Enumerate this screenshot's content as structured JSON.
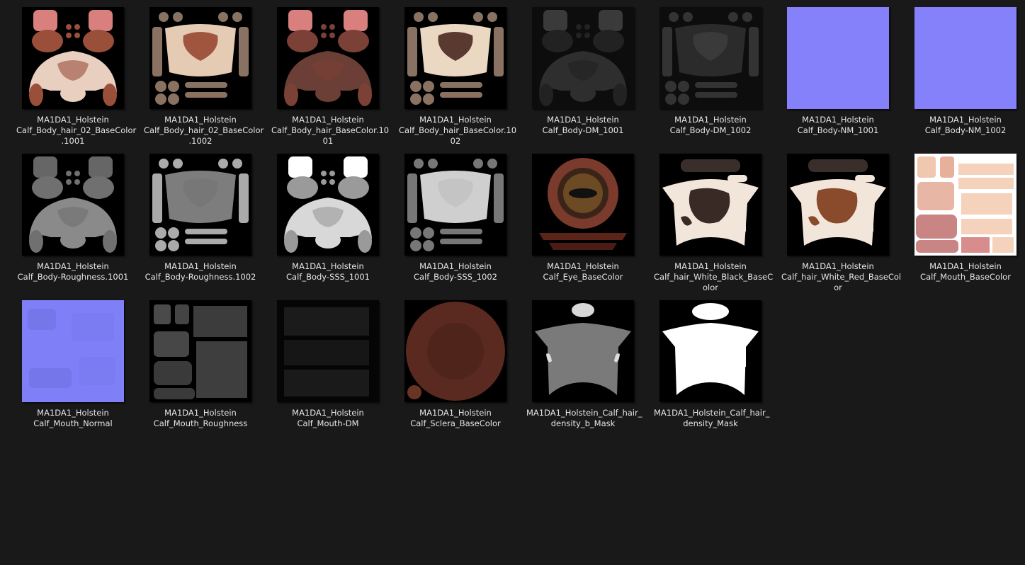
{
  "files": [
    {
      "name": "MA1DA1_Holstein\nCalf_Body_hair_02_BaseColor\n.1001",
      "thumb": "body-color-a"
    },
    {
      "name": "MA1DA1_Holstein\nCalf_Body_hair_02_BaseColor\n.1002",
      "thumb": "hide-color-a"
    },
    {
      "name": "MA1DA1_Holstein\nCalf_Body_hair_BaseColor.10\n01",
      "thumb": "body-color-b"
    },
    {
      "name": "MA1DA1_Holstein\nCalf_Body_hair_BaseColor.10\n02",
      "thumb": "hide-color-b"
    },
    {
      "name": "MA1DA1_Holstein\nCalf_Body-DM_1001",
      "thumb": "body-dm"
    },
    {
      "name": "MA1DA1_Holstein\nCalf_Body-DM_1002",
      "thumb": "hide-dm"
    },
    {
      "name": "MA1DA1_Holstein\nCalf_Body-NM_1001",
      "thumb": "normal-flat"
    },
    {
      "name": "MA1DA1_Holstein\nCalf_Body-NM_1002",
      "thumb": "normal-flat"
    },
    {
      "name": "MA1DA1_Holstein\nCalf_Body-Roughness.1001",
      "thumb": "body-rough"
    },
    {
      "name": "MA1DA1_Holstein\nCalf_Body-Roughness.1002",
      "thumb": "hide-rough"
    },
    {
      "name": "MA1DA1_Holstein\nCalf_Body-SSS_1001",
      "thumb": "body-sss"
    },
    {
      "name": "MA1DA1_Holstein\nCalf_Body-SSS_1002",
      "thumb": "hide-sss"
    },
    {
      "name": "MA1DA1_Holstein\nCalf_Eye_BaseColor",
      "thumb": "eye"
    },
    {
      "name": "MA1DA1_Holstein\nCalf_hair_White_Black_BaseC\nolor",
      "thumb": "pelt-black"
    },
    {
      "name": "MA1DA1_Holstein\nCalf_hair_White_Red_BaseCol\nor",
      "thumb": "pelt-red"
    },
    {
      "name": "MA1DA1_Holstein\nCalf_Mouth_BaseColor",
      "thumb": "mouth-color"
    },
    {
      "name": "MA1DA1_Holstein\nCalf_Mouth_Normal",
      "thumb": "mouth-normal"
    },
    {
      "name": "MA1DA1_Holstein\nCalf_Mouth_Roughness",
      "thumb": "mouth-rough"
    },
    {
      "name": "MA1DA1_Holstein\nCalf_Mouth-DM",
      "thumb": "mouth-dm"
    },
    {
      "name": "MA1DA1_Holstein\nCalf_Sclera_BaseColor",
      "thumb": "sclera"
    },
    {
      "name": "MA1DA1_Holstein_Calf_hair_\ndensity_b_Mask",
      "thumb": "mask-gray"
    },
    {
      "name": "MA1DA1_Holstein_Calf_hair_\ndensity_Mask",
      "thumb": "mask-white"
    }
  ],
  "colors": {
    "background": "#191919",
    "text": "#e6e6e6",
    "normal_map": "#8080fe"
  }
}
